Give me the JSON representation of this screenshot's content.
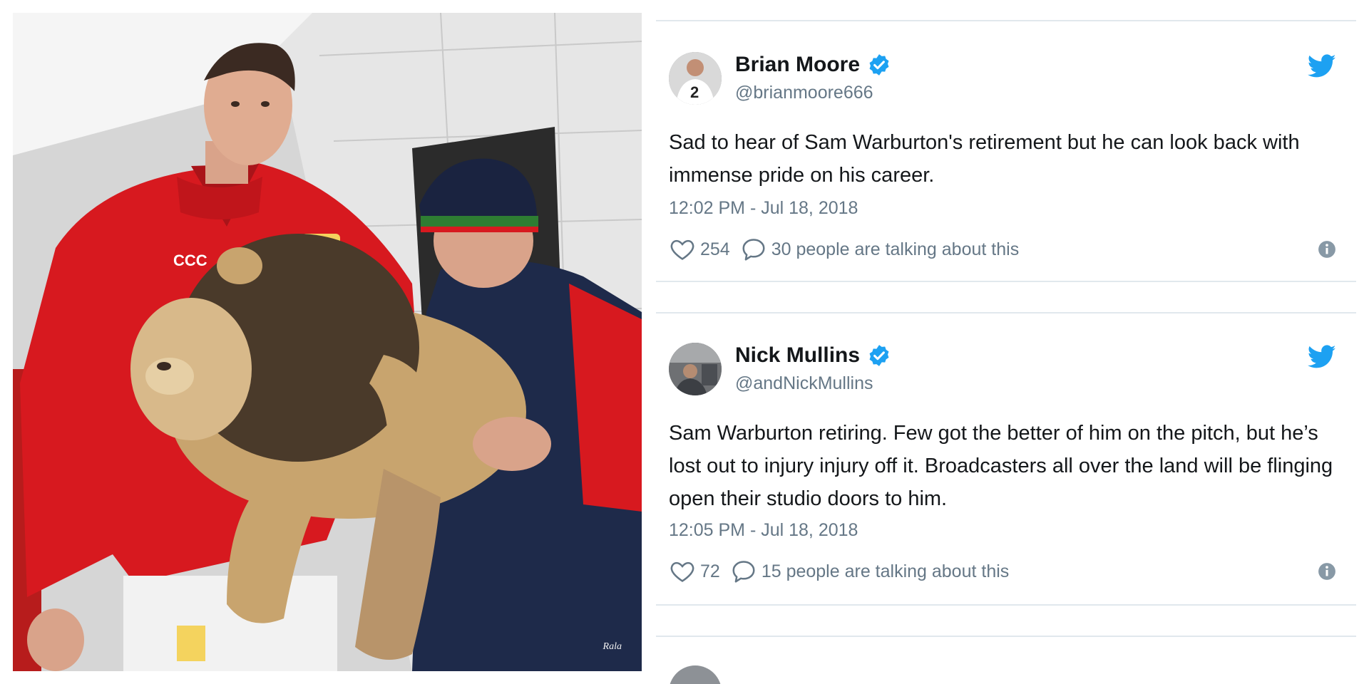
{
  "photo": {
    "watermark": "Rala"
  },
  "tweets": [
    {
      "author_name": "Brian Moore",
      "handle": "@brianmoore666",
      "verified": true,
      "text": "Sad to hear of Sam Warburton's retirement but he can look back with immense pride on his career.",
      "timestamp": "12:02 PM - Jul 18, 2018",
      "likes": "254",
      "talking": "30 people are talking about this"
    },
    {
      "author_name": "Nick Mullins",
      "handle": "@andNickMullins",
      "verified": true,
      "text": "Sam Warburton retiring. Few got the better of him on the pitch, but he’s lost out to injury injury off it. Broadcasters all over the land will be flinging open their studio doors to him.",
      "timestamp": "12:05 PM - Jul 18, 2018",
      "likes": "72",
      "talking": "15 people are talking about this"
    }
  ],
  "colors": {
    "twitter_blue": "#1da1f2",
    "text_primary": "#14171a",
    "text_secondary": "#657786",
    "divider": "#e1e8ed",
    "jersey_red": "#d7191f"
  },
  "icons": {
    "verified": "verified-badge-icon",
    "twitter": "twitter-bird-icon",
    "like": "heart-icon",
    "reply": "speech-bubble-icon",
    "info": "info-icon"
  }
}
